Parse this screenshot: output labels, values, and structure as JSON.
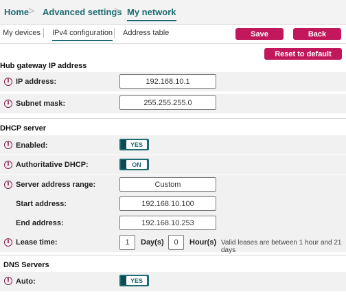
{
  "breadcrumb": {
    "home": "Home",
    "advanced": "Advanced settings",
    "current": "My network",
    "separator": ">"
  },
  "subnav": {
    "tabs": [
      {
        "label": "My devices",
        "active": false
      },
      {
        "label": "IPv4 configuration",
        "active": true
      },
      {
        "label": "Address table",
        "active": false
      }
    ]
  },
  "actions": {
    "save": "Save",
    "back": "Back",
    "reset": "Reset to default"
  },
  "hub_gateway": {
    "title": "Hub gateway IP address",
    "ip_label": "IP address:",
    "ip_value": "192.168.10.1",
    "subnet_label": "Subnet mask:",
    "subnet_value": "255.255.255.0"
  },
  "dhcp": {
    "title": "DHCP server",
    "enabled_label": "Enabled:",
    "enabled_value": "YES",
    "authoritative_label": "Authoritative DHCP:",
    "authoritative_value": "ON",
    "range_label": "Server address range:",
    "range_value": "Custom",
    "start_label": "Start address:",
    "start_value": "192.168.10.100",
    "end_label": "End address:",
    "end_value": "192.168.10.253",
    "lease_label": "Lease time:",
    "lease_days": "1",
    "days_unit": "Day(s)",
    "lease_hours": "0",
    "hours_unit": "Hour(s)",
    "lease_hint": "Valid leases are between 1 hour and 21 days"
  },
  "dns": {
    "title": "DNS Servers",
    "auto_label": "Auto:",
    "auto_value": "YES"
  },
  "colors": {
    "accent": "#1f6b73",
    "brand": "#c2185b",
    "info": "#8a1b4e"
  },
  "icons": {
    "info": "info-icon",
    "chevron": "chevron-right-icon"
  }
}
